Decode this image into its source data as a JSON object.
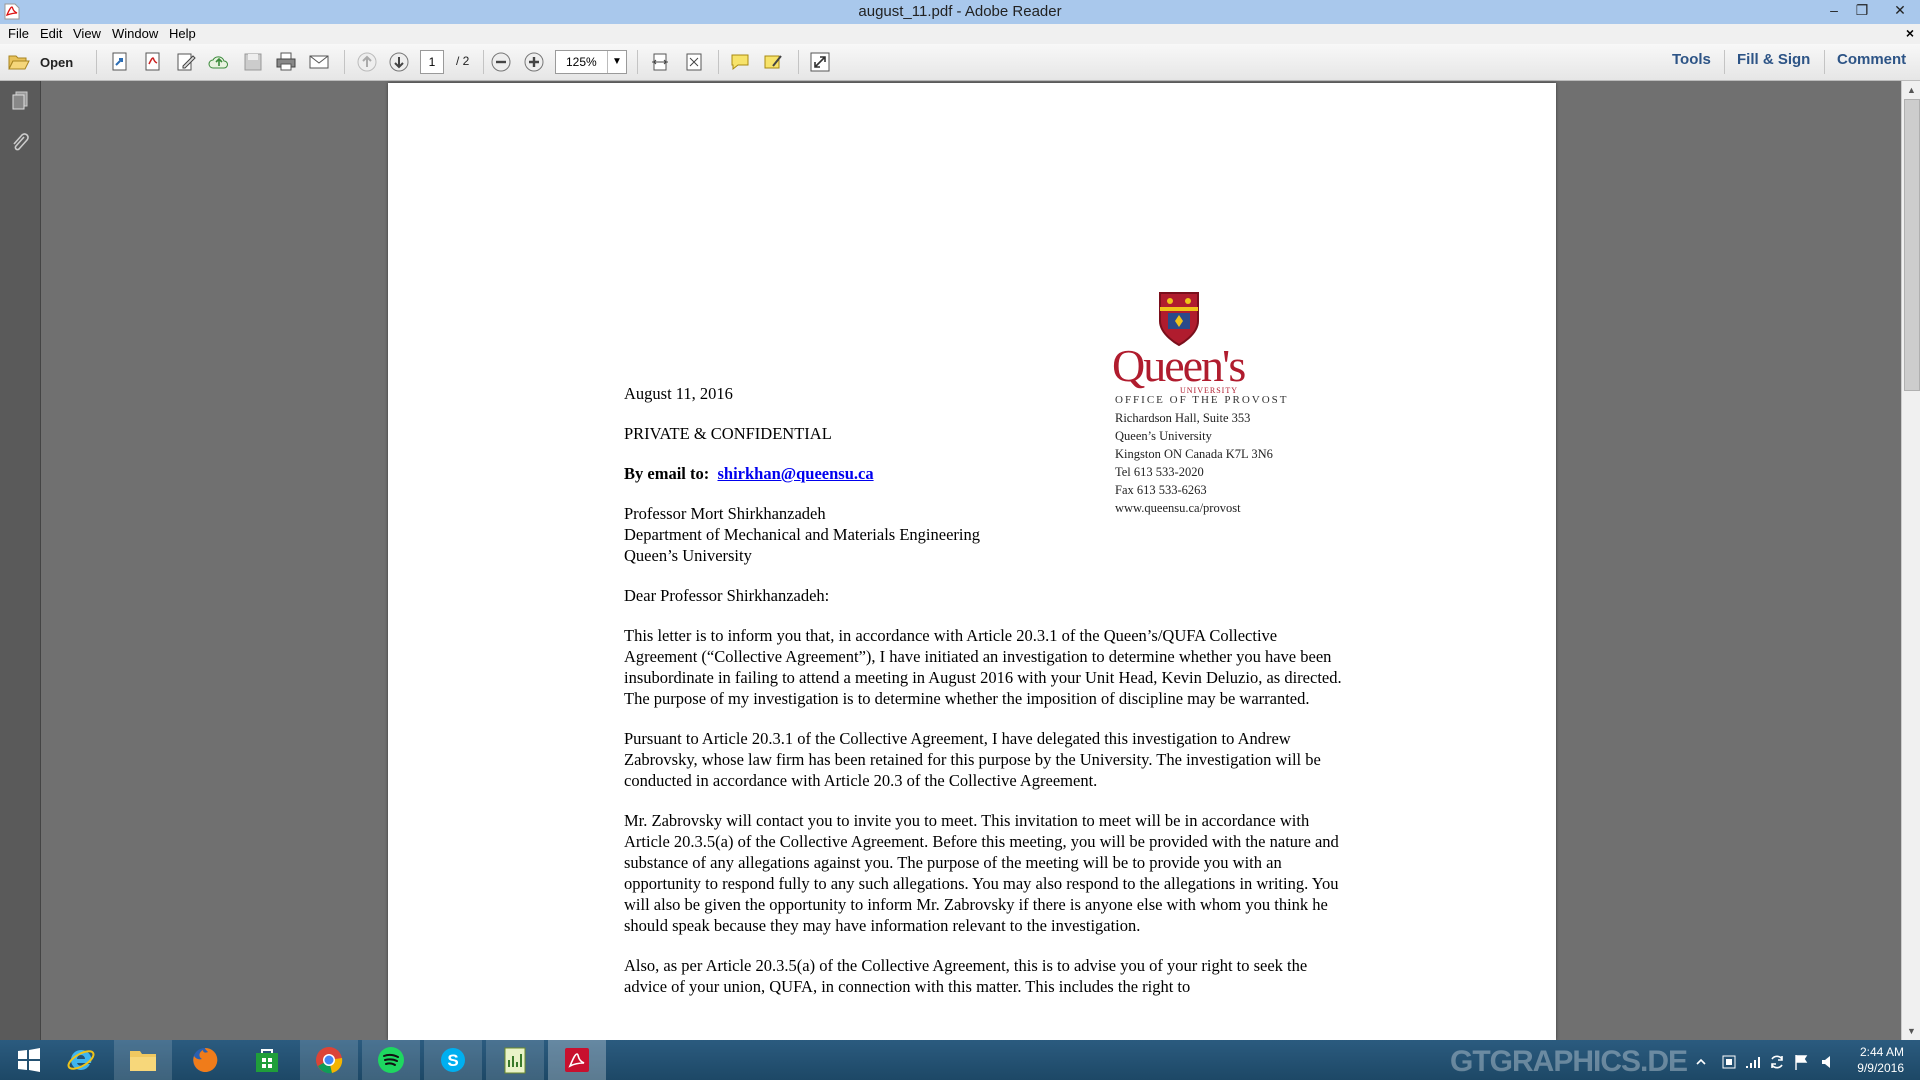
{
  "window": {
    "title": "august_11.pdf - Adobe Reader"
  },
  "menu": [
    "File",
    "Edit",
    "View",
    "Window",
    "Help"
  ],
  "toolbar": {
    "open_label": "Open",
    "page_current": "1",
    "page_total": "/ 2",
    "zoom": "125%",
    "right": [
      "Tools",
      "Fill & Sign",
      "Comment"
    ]
  },
  "document": {
    "address": {
      "office": "OFFICE OF THE PROVOST",
      "lines": [
        "Richardson Hall, Suite 353",
        "Queen’s University",
        "Kingston ON Canada K7L 3N6",
        "Tel  613 533-2020",
        "Fax  613 533-6263",
        "www.queensu.ca/provost"
      ]
    },
    "logo": {
      "name": "Queen's",
      "sub": "UNIVERSITY"
    },
    "date": "August 11, 2016",
    "confidential": "PRIVATE & CONFIDENTIAL",
    "email_label": "By email to:",
    "email": "shirkhan@queensu.ca",
    "recipient": [
      "Professor Mort Shirkhanzadeh",
      "Department of Mechanical and Materials Engineering",
      "Queen’s University"
    ],
    "salutation": "Dear Professor Shirkhanzadeh:",
    "paragraphs": [
      "This letter is to inform you that, in accordance with Article 20.3.1 of the Queen’s/QUFA Collective Agreement (“Collective Agreement”), I have initiated an investigation to determine whether you have been insubordinate in failing to attend a meeting in August 2016 with your Unit Head, Kevin Deluzio, as directed. The purpose of my investigation is to determine whether the imposition of discipline may be warranted.",
      "Pursuant to Article 20.3.1 of the Collective Agreement, I have delegated this investigation to Andrew Zabrovsky, whose law firm has been retained for this purpose by the University. The investigation will be conducted in accordance with Article 20.3 of the Collective Agreement.",
      "Mr. Zabrovsky will contact you to invite you to meet. This invitation to meet will be in accordance with Article 20.3.5(a) of the Collective Agreement.  Before this meeting, you will be provided with the nature and substance of any allegations against you. The purpose of the meeting will be to provide you with an opportunity to respond fully to any such allegations. You may also respond to the allegations in writing. You will also be given the opportunity to inform Mr. Zabrovsky if there is anyone else with whom you think he should speak because they may have information relevant to the investigation.",
      "Also, as per Article 20.3.5(a) of the Collective Agreement, this is to advise you of your right to seek the advice of your union, QUFA, in connection with this matter. This includes the right to"
    ]
  },
  "taskbar": {
    "watermark": "GTGRAPHICS.DE",
    "time": "2:44 AM",
    "date": "9/9/2016"
  }
}
